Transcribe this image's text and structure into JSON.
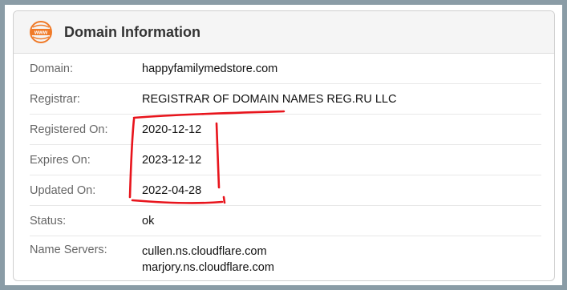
{
  "header": {
    "title": "Domain Information",
    "icon": "www-icon",
    "icon_text": "www",
    "accent": "#f07a28"
  },
  "rows": [
    {
      "label": "Domain:",
      "value": "happyfamilymedstore.com"
    },
    {
      "label": "Registrar:",
      "value": "REGISTRAR OF DOMAIN NAMES REG.RU LLC"
    },
    {
      "label": "Registered On:",
      "value": "2020-12-12"
    },
    {
      "label": "Expires On:",
      "value": "2023-12-12"
    },
    {
      "label": "Updated On:",
      "value": "2022-04-28"
    },
    {
      "label": "Status:",
      "value": "ok"
    },
    {
      "label": "Name Servers:",
      "values": [
        "cullen.ns.cloudflare.com",
        "marjory.ns.cloudflare.com"
      ]
    }
  ],
  "annotation_color": "#e8141c"
}
